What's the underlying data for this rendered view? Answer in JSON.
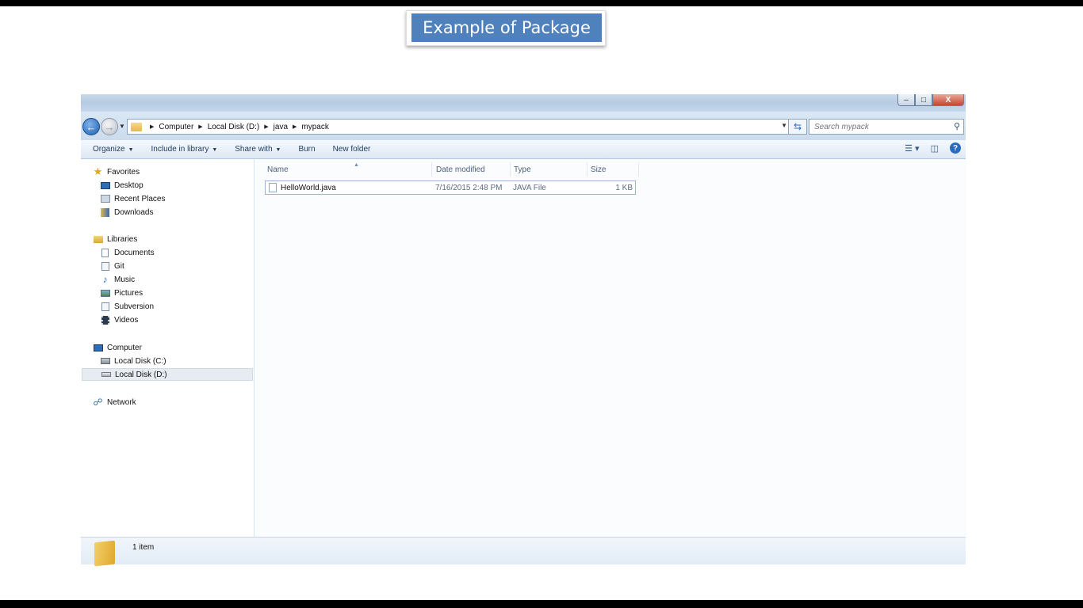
{
  "slide": {
    "title": "Example of Package"
  },
  "window": {
    "caption_buttons": {
      "minimize": "–",
      "maximize": "□",
      "close": "X"
    },
    "nav": {
      "back_icon": "back-arrow-icon",
      "forward_icon": "forward-arrow-icon"
    },
    "breadcrumb": [
      "Computer",
      "Local Disk (D:)",
      "java",
      "mypack"
    ],
    "search": {
      "placeholder": "Search mypack"
    },
    "toolbar": {
      "organize": "Organize",
      "include_in_library": "Include in library",
      "share_with": "Share with",
      "burn": "Burn",
      "new_folder": "New folder"
    },
    "sidebar": {
      "favorites": {
        "label": "Favorites",
        "items": [
          "Desktop",
          "Recent Places",
          "Downloads"
        ]
      },
      "libraries": {
        "label": "Libraries",
        "items": [
          "Documents",
          "Git",
          "Music",
          "Pictures",
          "Subversion",
          "Videos"
        ]
      },
      "computer": {
        "label": "Computer",
        "items": [
          "Local Disk (C:)",
          "Local Disk (D:)"
        ]
      },
      "network": {
        "label": "Network"
      }
    },
    "columns": {
      "name": "Name",
      "date_modified": "Date modified",
      "type": "Type",
      "size": "Size"
    },
    "files": [
      {
        "name": "HelloWorld.java",
        "date_modified": "7/16/2015 2:48 PM",
        "type": "JAVA File",
        "size": "1 KB"
      }
    ],
    "status": {
      "item_count": "1 item"
    }
  }
}
